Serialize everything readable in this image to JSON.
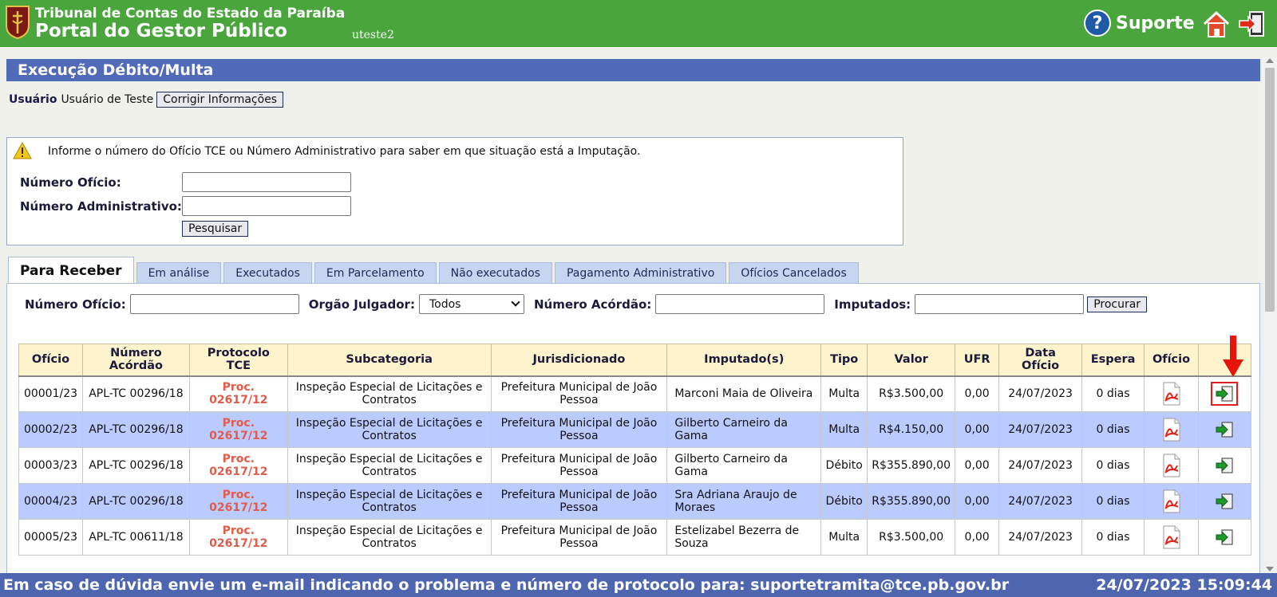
{
  "header": {
    "org_name": "Tribunal de Contas do Estado da Paraíba",
    "portal_name": "Portal do Gestor Público",
    "username": "uteste2",
    "support_label": "Suporte",
    "support_icon": "question-circle-icon",
    "home_icon": "home-icon",
    "exit_icon": "exit-icon"
  },
  "page": {
    "title": "Execução Débito/Multa",
    "user_label": "Usuário",
    "user_name": "Usuário de Teste",
    "fix_info_button": "Corrigir Informações"
  },
  "search": {
    "info_text": "Informe o número do Ofício TCE ou Número Administrativo para saber em que situação está a Imputação.",
    "oficio_label": "Número Ofício:",
    "oficio_value": "",
    "admin_label": "Número Administrativo:",
    "admin_value": "",
    "search_button": "Pesquisar"
  },
  "tabs": [
    {
      "label": "Para Receber",
      "active": true
    },
    {
      "label": "Em análise"
    },
    {
      "label": "Executados"
    },
    {
      "label": "Em Parcelamento"
    },
    {
      "label": "Não executados"
    },
    {
      "label": "Pagamento Administrativo"
    },
    {
      "label": "Ofícios Cancelados"
    }
  ],
  "filters": {
    "oficio_label": "Número Ofício:",
    "orgao_label": "Orgão Julgador:",
    "orgao_selected": "Todos",
    "acordao_label": "Número Acórdão:",
    "imputados_label": "Imputados:",
    "search_button": "Procurar"
  },
  "table": {
    "headers": {
      "oficio": "Ofício",
      "acordao_1": "Número",
      "acordao_2": "Acórdão",
      "protocolo_1": "Protocolo",
      "protocolo_2": "TCE",
      "subcategoria": "Subcategoria",
      "jurisdicionado": "Jurisdicionado",
      "imputados": "Imputado(s)",
      "tipo": "Tipo",
      "valor": "Valor",
      "ufr": "UFR",
      "data_1": "Data",
      "data_2": "Ofício",
      "espera": "Espera",
      "oficio_doc": "Ofício"
    },
    "rows": [
      {
        "oficio": "00001/23",
        "acordao": "APL-TC 00296/18",
        "proc_1": "Proc.",
        "proc_2": "02617/12",
        "sub_1": "Inspeção Especial de Licitações e",
        "sub_2": "Contratos",
        "jur_1": "Prefeitura Municipal de João",
        "jur_2": "Pessoa",
        "imp_1": "Marconi Maia de Oliveira",
        "imp_2": "",
        "tipo": "Multa",
        "valor": "R$3.500,00",
        "ufr": "0,00",
        "data": "24/07/2023",
        "espera": "0 dias"
      },
      {
        "oficio": "00002/23",
        "acordao": "APL-TC 00296/18",
        "proc_1": "Proc.",
        "proc_2": "02617/12",
        "sub_1": "Inspeção Especial de Licitações e",
        "sub_2": "Contratos",
        "jur_1": "Prefeitura Municipal de João",
        "jur_2": "Pessoa",
        "imp_1": "Gilberto Carneiro da",
        "imp_2": "Gama",
        "tipo": "Multa",
        "valor": "R$4.150,00",
        "ufr": "0,00",
        "data": "24/07/2023",
        "espera": "0 dias"
      },
      {
        "oficio": "00003/23",
        "acordao": "APL-TC 00296/18",
        "proc_1": "Proc.",
        "proc_2": "02617/12",
        "sub_1": "Inspeção Especial de Licitações e",
        "sub_2": "Contratos",
        "jur_1": "Prefeitura Municipal de João",
        "jur_2": "Pessoa",
        "imp_1": "Gilberto Carneiro da",
        "imp_2": "Gama",
        "tipo": "Débito",
        "valor": "R$355.890,00",
        "ufr": "0,00",
        "data": "24/07/2023",
        "espera": "0 dias"
      },
      {
        "oficio": "00004/23",
        "acordao": "APL-TC 00296/18",
        "proc_1": "Proc.",
        "proc_2": "02617/12",
        "sub_1": "Inspeção Especial de Licitações e",
        "sub_2": "Contratos",
        "jur_1": "Prefeitura Municipal de João",
        "jur_2": "Pessoa",
        "imp_1": "Sra Adriana Araujo de",
        "imp_2": "Moraes",
        "tipo": "Débito",
        "valor": "R$355.890,00",
        "ufr": "0,00",
        "data": "24/07/2023",
        "espera": "0 dias"
      },
      {
        "oficio": "00005/23",
        "acordao": "APL-TC 00611/18",
        "proc_1": "Proc.",
        "proc_2": "02617/12",
        "sub_1": "Inspeção Especial de Licitações e",
        "sub_2": "Contratos",
        "jur_1": "Prefeitura Municipal de João",
        "jur_2": "Pessoa",
        "imp_1": "Estelizabel Bezerra de",
        "imp_2": "Souza",
        "tipo": "Multa",
        "valor": "R$3.500,00",
        "ufr": "0,00",
        "data": "24/07/2023",
        "espera": "0 dias"
      }
    ]
  },
  "footer": {
    "message": "Em caso de dúvida envie um e-mail indicando o problema e número de protocolo para: suportetramita@tce.pb.gov.br",
    "datetime": "24/07/2023 15:09:44"
  },
  "colors": {
    "header_bg": "#4aa63c",
    "title_bar": "#526bb8",
    "footer_bg": "#4e66b0",
    "row_alt": "#bccbff",
    "table_header": "#fdf3cc",
    "protocol_text": "#e25c4a",
    "highlight": "#e02020"
  }
}
